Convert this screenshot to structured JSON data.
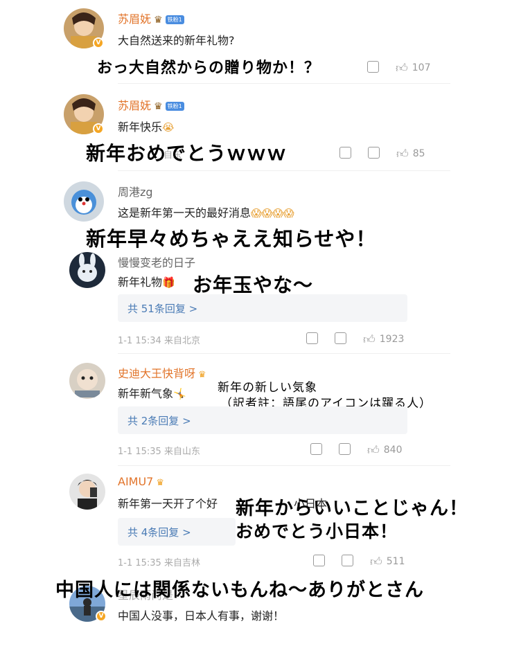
{
  "comments": [
    {
      "username": "苏眉妩",
      "badge": "铁粉1",
      "text": "大自然送来的新年礼物?",
      "likes": "107",
      "overlay": "おっ大自然からの贈り物か！？"
    },
    {
      "username": "苏眉妩",
      "badge": "铁粉1",
      "text": "新年快乐",
      "emoji": "😭",
      "meta": "自东",
      "likes": "85",
      "overlay": "新年おめでとうｗｗｗ"
    },
    {
      "username": "周港zg",
      "text": "这是新年第一天的最好消息",
      "emoji": "😱😱😱😱",
      "overlay": "新年早々めちゃええ知らせや！"
    },
    {
      "username": "慢慢变老的日子",
      "text": "新年礼物",
      "emoji": "🎁",
      "replies": "共 51条回复 >",
      "meta": "1-1 15:34  来自北京",
      "likes": "1923",
      "overlay": "お年玉やな～"
    },
    {
      "username": "史迪大王快背呀",
      "text": "新年新气象",
      "emoji": "🤸",
      "replies": "共 2条回复 >",
      "meta": "1-1 15:35  来自山东",
      "likes": "840",
      "overlay_line1": "新年の新しい気象",
      "overlay_line2": "（訳者註：語尾のアイコンは躍る人）"
    },
    {
      "username": "AIMU7",
      "text": "新年第一天开了个好",
      "text_tail": "小日本",
      "replies": "共 4条回复 >",
      "meta": "1-1 15:35  来自吉林",
      "likes": "511",
      "overlay_line1": "新年からいいことじゃん！",
      "overlay_line2": "おめでとう小日本！"
    },
    {
      "username": "星辰雨尚是",
      "text": "中国人没事，日本人有事，谢谢！",
      "overlay": "中国人には関係ないもんね～ありがとさん"
    }
  ]
}
